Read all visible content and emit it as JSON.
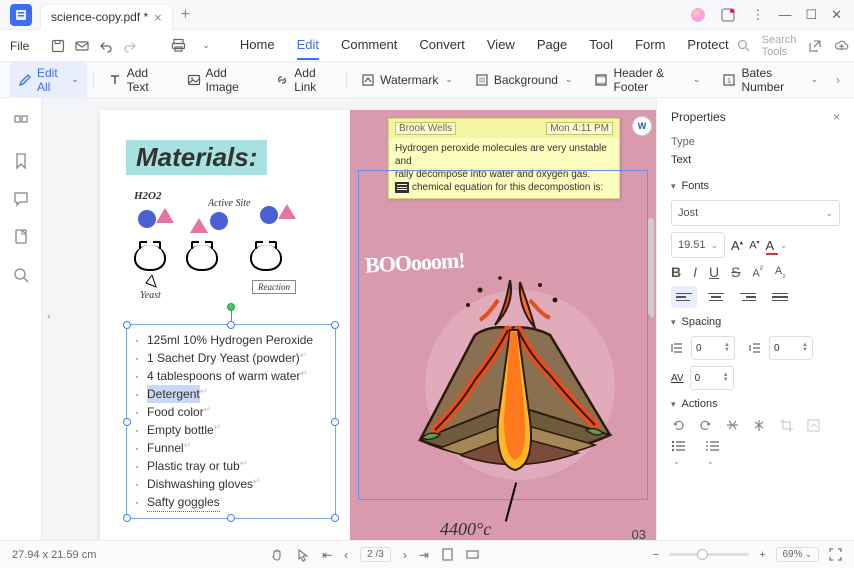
{
  "titlebar": {
    "filename": "science-copy.pdf *"
  },
  "menu": {
    "file": "File",
    "tabs": [
      "Home",
      "Edit",
      "Comment",
      "Convert",
      "View",
      "Page",
      "Tool",
      "Form",
      "Protect"
    ],
    "active_tab": "Edit",
    "search_placeholder": "Search Tools"
  },
  "toolbar": {
    "edit_all": "Edit All",
    "add_text": "Add Text",
    "add_image": "Add Image",
    "add_link": "Add Link",
    "watermark": "Watermark",
    "background": "Background",
    "header_footer": "Header & Footer",
    "bates_number": "Bates Number"
  },
  "page_content": {
    "heading": "Materials:",
    "diagram": {
      "h2o2": "H2O2",
      "active_site": "Active Site",
      "yeast": "Yeast",
      "reaction": "Reaction"
    },
    "list": [
      "125ml 10% Hydrogen Peroxide",
      "1 Sachet Dry Yeast (powder)",
      "4 tablespoons of warm water",
      "Detergent",
      "Food color",
      "Empty bottle",
      "Funnel",
      "Plastic tray or tub",
      "Dishwashing gloves",
      "Safty goggles"
    ],
    "comment": {
      "author": "Brook Wells",
      "time": "Mon 4:11 PM",
      "body_line1": "Hydrogen peroxide molecules are very unstable and",
      "body_line2": "rally decompose into water and oxygen gas.",
      "body_line3": "chemical equation for this decompostion is:"
    },
    "boom": "BOOooom!",
    "temperature": "4400°c",
    "page_number": "03"
  },
  "properties": {
    "title": "Properties",
    "type_label": "Type",
    "type_value": "Text",
    "fonts_label": "Fonts",
    "font_name": "Jost",
    "font_size": "19.51",
    "spacing_label": "Spacing",
    "spacing_values": {
      "line": "0",
      "para": "0",
      "char": "0"
    },
    "actions_label": "Actions"
  },
  "statusbar": {
    "dimensions": "27.94 x 21.59 cm",
    "page_indicator": "2 /3",
    "zoom": "69%"
  }
}
